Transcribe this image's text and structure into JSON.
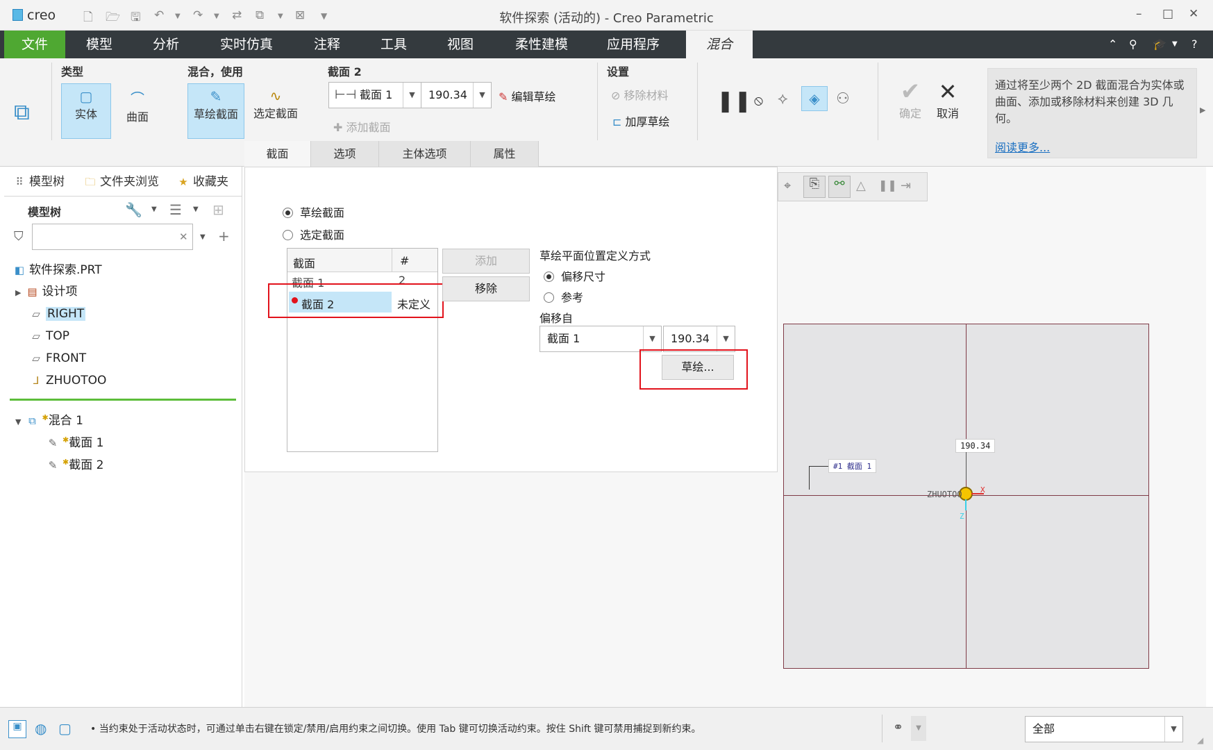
{
  "titlebar": {
    "logo": "creo",
    "window_title": "软件探索 (活动的) - Creo Parametric",
    "minimize": "–",
    "maximize": "□",
    "close": "✕"
  },
  "tabs": {
    "file": "文件",
    "model": "模型",
    "analysis": "分析",
    "realtime_sim": "实时仿真",
    "annotate": "注释",
    "tools": "工具",
    "view": "视图",
    "flexible": "柔性建模",
    "apps": "应用程序",
    "blend": "混合"
  },
  "ribbon": {
    "type_group": "类型",
    "solid": "实体",
    "surface": "曲面",
    "blend_group": "混合，使用",
    "sketched_sections": "草绘截面",
    "selected_sections": "选定截面",
    "section_group": "截面 2",
    "section_select": "截面 1",
    "offset_value": "190.34",
    "edit_sketch": "编辑草绘",
    "add_section": "添加截面",
    "settings_group": "设置",
    "remove_material": "移除材料",
    "thicken_sketch": "加厚草绘",
    "ok": "确定",
    "cancel": "取消"
  },
  "help": {
    "text": "通过将至少两个 2D 截面混合为实体或曲面、添加或移除材料来创建 3D 几何。",
    "link": "阅读更多..."
  },
  "dashboard_tabs": [
    "截面",
    "选项",
    "主体选项",
    "属性"
  ],
  "left_panel": {
    "tab_model_tree": "模型树",
    "tab_folder_browser": "文件夹浏览",
    "tab_favorites": "收藏夹",
    "tree_header": "模型树",
    "search_placeholder": "",
    "items": {
      "part": "软件探索.PRT",
      "design_items": "设计项",
      "right": "RIGHT",
      "top": "TOP",
      "front": "FRONT",
      "csys": "ZHUOTOO",
      "blend": "混合 1",
      "section1": "截面 1",
      "section2": "截面 2"
    }
  },
  "panel": {
    "radio_sketched": "草绘截面",
    "radio_selected": "选定截面",
    "table": {
      "col_section": "截面",
      "col_num": "#",
      "rows": [
        {
          "name": "截面 1",
          "num": "2"
        },
        {
          "name": "截面 2",
          "num": "未定义"
        }
      ]
    },
    "add": "添加",
    "remove": "移除",
    "placement_label": "草绘平面位置定义方式",
    "offset_dim": "偏移尺寸",
    "reference": "参考",
    "offset_from": "偏移自",
    "offset_from_value": "截面 1",
    "offset_value": "190.34",
    "sketch_btn": "草绘..."
  },
  "graphics": {
    "dimension": "190.34",
    "section_label": "#1 截面 1",
    "csys_label": "ZHUOTOO",
    "axis_x": "X",
    "axis_z": "Z"
  },
  "status": {
    "message": "• 当约束处于活动状态时，可通过单击右键在锁定/禁用/启用约束之间切换。使用 Tab 键可切换活动约束。按住 Shift 键可禁用捕捉到新约束。",
    "filter": "全部"
  },
  "colors": {
    "file_tab": "#4fa832",
    "tab_bar": "#343a3e",
    "selection": "#c5e6f8",
    "highlight_box": "#e2121b"
  }
}
